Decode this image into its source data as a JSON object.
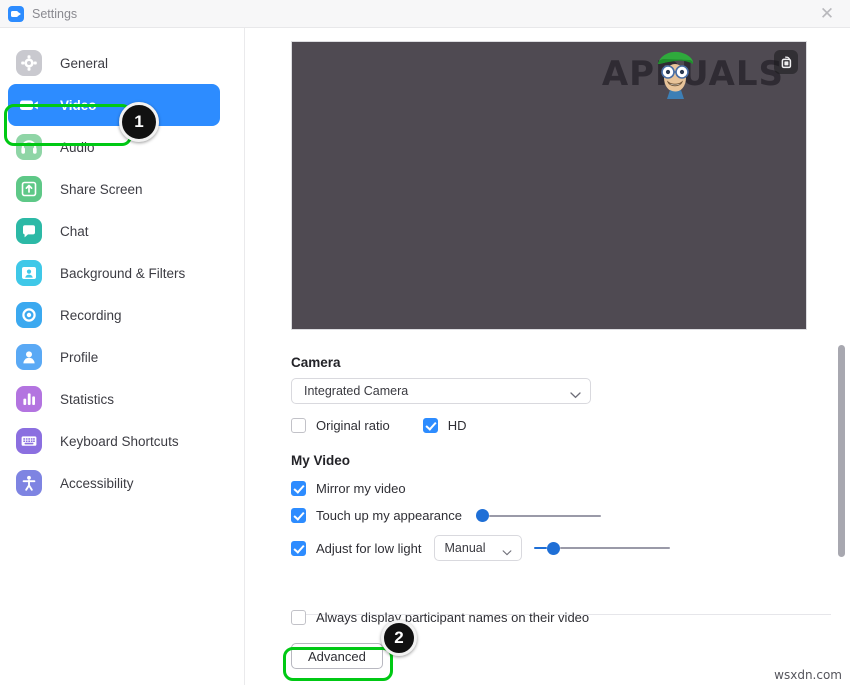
{
  "window": {
    "title": "Settings",
    "app_icon": "zoom-video-icon",
    "close_label": "✕"
  },
  "sidebar": {
    "items": [
      {
        "label": "General",
        "icon": "gear-icon",
        "color": "#c9c9cf",
        "active": false
      },
      {
        "label": "Video",
        "icon": "video-camera-icon",
        "color": "#2d8cff",
        "active": true
      },
      {
        "label": "Audio",
        "icon": "headphones-icon",
        "color": "#8fd5a6",
        "active": false
      },
      {
        "label": "Share Screen",
        "icon": "upload-box-icon",
        "color": "#5ec887",
        "active": false
      },
      {
        "label": "Chat",
        "icon": "chat-bubble-icon",
        "color": "#2cb9a6",
        "active": false
      },
      {
        "label": "Background & Filters",
        "icon": "person-frame-icon",
        "color": "#3fc8e8",
        "active": false
      },
      {
        "label": "Recording",
        "icon": "record-circle-icon",
        "color": "#3ba9f0",
        "active": false
      },
      {
        "label": "Profile",
        "icon": "person-icon",
        "color": "#5aa9f5",
        "active": false
      },
      {
        "label": "Statistics",
        "icon": "bar-chart-icon",
        "color": "#b374e0",
        "active": false
      },
      {
        "label": "Keyboard Shortcuts",
        "icon": "keyboard-icon",
        "color": "#8b6fe0",
        "active": false
      },
      {
        "label": "Accessibility",
        "icon": "accessibility-icon",
        "color": "#7e84e2",
        "active": false
      }
    ]
  },
  "annotations": {
    "highlight_color": "#00c914",
    "badges": [
      {
        "number": "1",
        "target": "sidebar-item-video"
      },
      {
        "number": "2",
        "target": "advanced-button"
      }
    ]
  },
  "video_preview": {
    "watermark_text": "APPUALS",
    "background_color": "#4f4a52",
    "rotate_icon": "rotate-camera-icon"
  },
  "camera_section": {
    "title": "Camera",
    "select_value": "Integrated Camera",
    "checkboxes": [
      {
        "label": "Original ratio",
        "checked": false
      },
      {
        "label": "HD",
        "checked": true
      }
    ]
  },
  "my_video_section": {
    "title": "My Video",
    "mirror": {
      "label": "Mirror my video",
      "checked": true
    },
    "touch_up": {
      "label": "Touch up my appearance",
      "checked": true,
      "slider_value": 5
    },
    "low_light": {
      "label": "Adjust for low light",
      "checked": true,
      "mode": "Manual",
      "slider_value": 18
    }
  },
  "bottom_section": {
    "always_display_names": {
      "label": "Always display participant names on their video",
      "checked": false
    },
    "advanced_label": "Advanced"
  },
  "footer": {
    "site_watermark": "wsxdn.com"
  }
}
